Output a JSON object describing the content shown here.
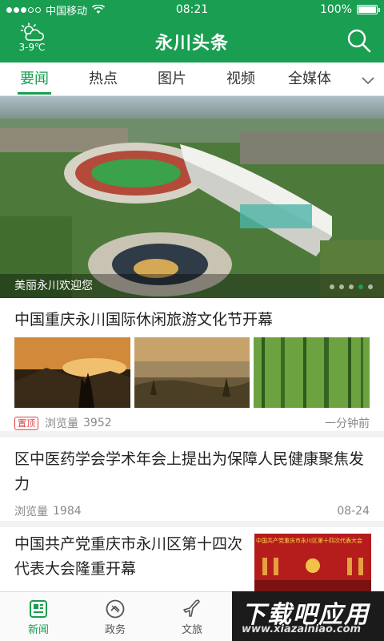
{
  "status_bar": {
    "carrier": "中国移动",
    "time": "08:21",
    "battery_text": "100%",
    "battery_level": 1.0
  },
  "app_bar": {
    "title": "永川头条",
    "weather_temp": "3-9℃",
    "weather_icon": "cloudy-sun-icon",
    "search_icon": "search-icon"
  },
  "tabs": [
    {
      "label": "要闻",
      "active": true
    },
    {
      "label": "热点",
      "active": false
    },
    {
      "label": "图片",
      "active": false
    },
    {
      "label": "视频",
      "active": false
    },
    {
      "label": "全媒体",
      "active": false
    }
  ],
  "banner": {
    "caption": "美丽永川欢迎您",
    "slides": 5,
    "active_slide": 3
  },
  "articles": [
    {
      "title": "中国重庆永川国际休闲旅游文化节开幕",
      "badge": "置顶",
      "views_label": "浏览量",
      "views": "3952",
      "time": "一分钟前"
    },
    {
      "title": "区中医药学会学术年会上提出为保障人民健康聚焦发力",
      "views_label": "浏览量",
      "views": "1984",
      "time": "08-24"
    },
    {
      "title": "中国共产党重庆市永川区第十四次代表大会隆重开幕",
      "thumb_caption": "中国共产党重庆市永川区第十四次代表大会"
    }
  ],
  "bottom_nav": [
    {
      "label": "新闻",
      "icon": "news-icon",
      "active": true
    },
    {
      "label": "政务",
      "icon": "government-icon",
      "active": false
    },
    {
      "label": "文旅",
      "icon": "plane-icon",
      "active": false
    }
  ],
  "watermark": {
    "text": "下载吧应用",
    "url": "www.xiazainiao.com"
  },
  "colors": {
    "brand": "#1a9e52",
    "pin": "#e04040"
  }
}
